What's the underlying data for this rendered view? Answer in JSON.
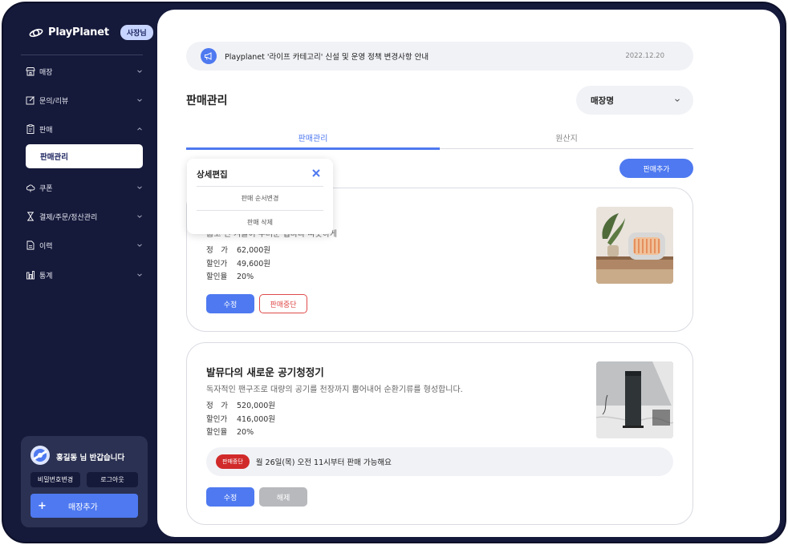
{
  "brand": {
    "name": "PlayPlanet",
    "role_badge": "사장님"
  },
  "nav": {
    "items": [
      {
        "label": "매장"
      },
      {
        "label": "문의/리뷰"
      },
      {
        "label": "판매"
      },
      {
        "label": "쿠폰"
      },
      {
        "label": "결제/주문/정산관리"
      },
      {
        "label": "이력"
      },
      {
        "label": "통계"
      }
    ],
    "sub_active": "판매관리"
  },
  "user": {
    "greeting": "홍길동 님 반갑습니다",
    "change_password": "비밀번호변경",
    "logout": "로그아웃",
    "add_store_plus": "+",
    "add_store": "매장추가"
  },
  "notice": {
    "text": "Playplanet '라이프 카테고리' 신설 및 운영 정책 변경사항 안내",
    "date": "2022.12.20"
  },
  "page": {
    "title": "판매관리",
    "store_select": "매장명"
  },
  "tabs": [
    {
      "label": "판매관리",
      "active": true
    },
    {
      "label": "원산지",
      "active": false
    }
  ],
  "add_sale_button": "판매추가",
  "popup": {
    "title": "상세편집",
    "items": [
      "판매 순서변경",
      "판매 삭제"
    ]
  },
  "products": [
    {
      "desc": "춥고 긴 겨울이 두려운 집마다 따뜻하게",
      "prices": [
        {
          "k": "정　가",
          "v": "62,000원"
        },
        {
          "k": "할인가",
          "v": "49,600원"
        },
        {
          "k": "할인율",
          "v": "20%"
        }
      ],
      "edit": "수정",
      "action": "판매중단"
    },
    {
      "title": "발뮤다의 새로운 공기청정기",
      "desc": "독자적인 팬구조로 대량의 공기를 천장까지 뿜어내어 순환기류를 형성합니다.",
      "prices": [
        {
          "k": "정　가",
          "v": "520,000원"
        },
        {
          "k": "할인가",
          "v": "416,000원"
        },
        {
          "k": "할인율",
          "v": "20%"
        }
      ],
      "stop_badge": "판매중단",
      "stop_text": "월 26일(목) 오전 11시부터 판매 가능해요",
      "edit": "수정",
      "action": "해제"
    }
  ],
  "colors": {
    "accent": "#4e79f0",
    "sidebar": "#15193a",
    "danger": "#d12a2a"
  }
}
